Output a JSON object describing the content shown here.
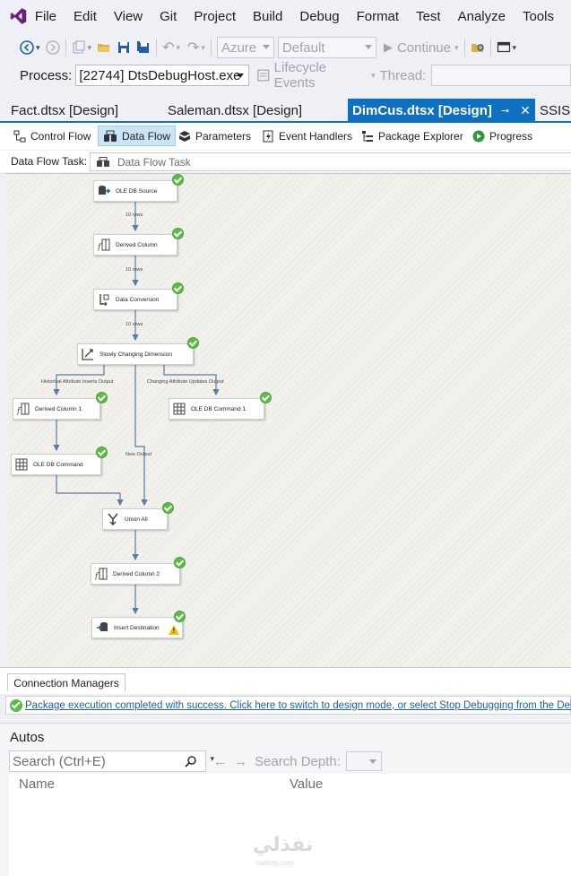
{
  "menu": [
    "File",
    "Edit",
    "View",
    "Git",
    "Project",
    "Build",
    "Debug",
    "Format",
    "Test",
    "Analyze",
    "Tools"
  ],
  "toolbar": {
    "platform": "Azure",
    "config": "Default",
    "continue_label": "Continue"
  },
  "debug_bar": {
    "process_label": "Process:",
    "process_value": "[22744] DtsDebugHost.exe",
    "lifecycle_label": "Lifecycle Events",
    "thread_label": "Thread:"
  },
  "doc_tabs": [
    {
      "label": "Fact.dtsx [Design]"
    },
    {
      "label": "Saleman.dtsx [Design]"
    },
    {
      "label": "DimCus.dtsx [Design]",
      "active": true
    },
    {
      "label": "SSISp"
    }
  ],
  "designer_tabs": [
    "Control Flow",
    "Data Flow",
    "Parameters",
    "Event Handlers",
    "Package Explorer",
    "Progress"
  ],
  "dataflow": {
    "task_label": "Data Flow Task:",
    "task_value": "Data Flow Task"
  },
  "nodes": {
    "oledb_source": "OLE DB Source",
    "derived_column": "Derived Column",
    "data_conversion": "Data Conversion",
    "scd": "Slowly Changing Dimension",
    "derived_column_1": "Derived Column 1",
    "oledb_command_1": "OLE DB Command 1",
    "oledb_command": "OLE DB Command",
    "union_all": "Union All",
    "derived_column_2": "Derived Column 2",
    "insert_destination": "Insert Destination"
  },
  "edges": {
    "rows_1": "10 rows",
    "rows_2": "10 rows",
    "rows_3": "10 rows",
    "historical": "Historical Attribute Inserts Output",
    "changing": "Changing Attribute Updates Output",
    "new_output": "New Output"
  },
  "connection_managers": "Connection Managers",
  "status_message": "Package execution completed with success. Click here to switch to design mode, or select Stop Debugging from the Debug menu.",
  "autos": {
    "title": "Autos",
    "search_placeholder": "Search (Ctrl+E)",
    "search_depth_label": "Search Depth:",
    "col_name": "Name",
    "col_value": "Value"
  },
  "watermark": {
    "main": "نفذلي",
    "sub": "nafezly.com"
  },
  "colors": {
    "accent": "#0e70c0",
    "success": "#5dbb46",
    "warning": "#f2c200",
    "link": "#1a5fb4"
  }
}
